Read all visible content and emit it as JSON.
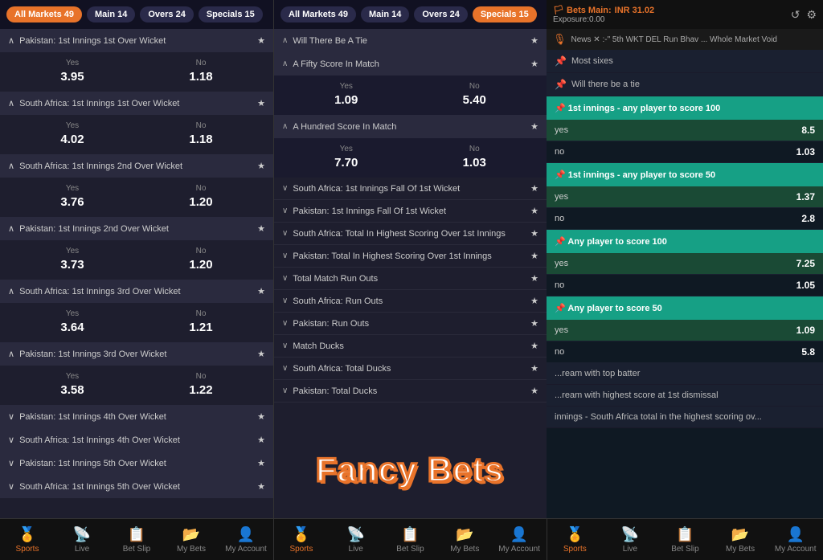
{
  "left_panel": {
    "filters": [
      {
        "label": "All Markets",
        "count": "49",
        "active": true
      },
      {
        "label": "Main",
        "count": "14",
        "active": false
      },
      {
        "label": "Overs",
        "count": "24",
        "active": false
      },
      {
        "label": "Specials",
        "count": "15",
        "active": false
      }
    ],
    "markets": [
      {
        "title": "Pakistan: 1st Innings 1st Over Wicket",
        "expanded": true,
        "yes": "3.95",
        "no": "1.18"
      },
      {
        "title": "South Africa: 1st Innings 1st Over Wicket",
        "expanded": true,
        "yes": "4.02",
        "no": "1.18"
      },
      {
        "title": "South Africa: 1st Innings 2nd Over Wicket",
        "expanded": true,
        "yes": "3.76",
        "no": "1.20"
      },
      {
        "title": "Pakistan: 1st Innings 2nd Over Wicket",
        "expanded": true,
        "yes": "3.73",
        "no": "1.20"
      },
      {
        "title": "South Africa: 1st Innings 3rd Over Wicket",
        "expanded": true,
        "yes": "3.64",
        "no": "1.21"
      },
      {
        "title": "Pakistan: 1st Innings 3rd Over Wicket",
        "expanded": true,
        "yes": "3.58",
        "no": "1.22"
      },
      {
        "title": "Pakistan: 1st Innings 4th Over Wicket",
        "expanded": false
      },
      {
        "title": "South Africa: 1st Innings 4th Over Wicket",
        "expanded": false
      },
      {
        "title": "Pakistan: 1st Innings 5th Over Wicket",
        "expanded": false
      },
      {
        "title": "South Africa: 1st Innings 5th Over Wicket",
        "expanded": false
      }
    ],
    "yes_label": "Yes",
    "no_label": "No"
  },
  "mid_panel": {
    "filters": [
      {
        "label": "All Markets",
        "count": "49",
        "active": false
      },
      {
        "label": "Main",
        "count": "14",
        "active": false
      },
      {
        "label": "Overs",
        "count": "24",
        "active": false
      },
      {
        "label": "Specials",
        "count": "15",
        "active": true
      }
    ],
    "sections": [
      {
        "type": "expanded",
        "title": "Will There Be A Tie",
        "has_odds": false
      },
      {
        "type": "expanded_odds",
        "title": "A Fifty Score In Match",
        "yes": "1.09",
        "no": "5.40"
      },
      {
        "type": "expanded_odds",
        "title": "A Hundred Score In Match",
        "yes": "7.70",
        "no": "1.03"
      },
      {
        "type": "collapsed",
        "title": "South Africa: 1st Innings Fall Of 1st Wicket"
      },
      {
        "type": "collapsed",
        "title": "Pakistan: 1st Innings Fall Of 1st Wicket"
      },
      {
        "type": "collapsed",
        "title": "South Africa: Total In Highest Scoring Over 1st Innings"
      },
      {
        "type": "collapsed",
        "title": "Pakistan: Total In Highest Scoring Over 1st Innings"
      },
      {
        "type": "collapsed",
        "title": "Total Match Run Outs"
      },
      {
        "type": "collapsed",
        "title": "South Africa: Run Outs"
      },
      {
        "type": "collapsed",
        "title": "Pakistan: Run Outs"
      },
      {
        "type": "collapsed",
        "title": "Match Ducks"
      },
      {
        "type": "collapsed",
        "title": "South Africa: Total Ducks"
      },
      {
        "type": "collapsed",
        "title": "Pakistan: Total Ducks"
      }
    ],
    "yes_label": "Yes",
    "no_label": "No"
  },
  "right_panel": {
    "header": {
      "type": "Main",
      "inr": "INR 31.02",
      "exposure": "Exposure:0.00"
    },
    "news_text": "News  ✕ :-\" 5th WKT DEL Run Bhav ... Whole Market Void",
    "bet_items": [
      {
        "label": "Most sixes",
        "pinned": false
      },
      {
        "label": "Will there be a tie",
        "pinned": false
      }
    ],
    "sections": [
      {
        "title": "1st innings - any player to score 100",
        "odds": [
          {
            "label": "yes",
            "value": "8.5",
            "green": true
          },
          {
            "label": "no",
            "value": "1.03",
            "green": false
          }
        ]
      },
      {
        "title": "1st innings - any player to score 50",
        "odds": [
          {
            "label": "yes",
            "value": "1.37",
            "green": true
          },
          {
            "label": "no",
            "value": "2.8",
            "green": false
          }
        ]
      },
      {
        "title": "Any player to score 100",
        "odds": [
          {
            "label": "yes",
            "value": "7.25",
            "green": true
          },
          {
            "label": "no",
            "value": "1.05",
            "green": false
          }
        ]
      },
      {
        "title": "Any player to score 50",
        "odds": [
          {
            "label": "yes",
            "value": "1.09",
            "green": true
          },
          {
            "label": "no",
            "value": "5.8",
            "green": false
          }
        ]
      }
    ],
    "extra_items": [
      {
        "label": "...ream with top batter"
      },
      {
        "label": "...ream with highest score at 1st dismissal"
      },
      {
        "label": "innings - South Africa total in the highest scoring ov..."
      }
    ]
  },
  "bottom_nav": {
    "items": [
      {
        "icon": "🏅",
        "label": "Sports"
      },
      {
        "icon": "📡",
        "label": "Live"
      },
      {
        "icon": "📋",
        "label": "Bet Slip"
      },
      {
        "icon": "📂",
        "label": "My Bets"
      },
      {
        "icon": "👤",
        "label": "My Account"
      }
    ]
  },
  "fancy_bets_label": "Fancy Bets"
}
